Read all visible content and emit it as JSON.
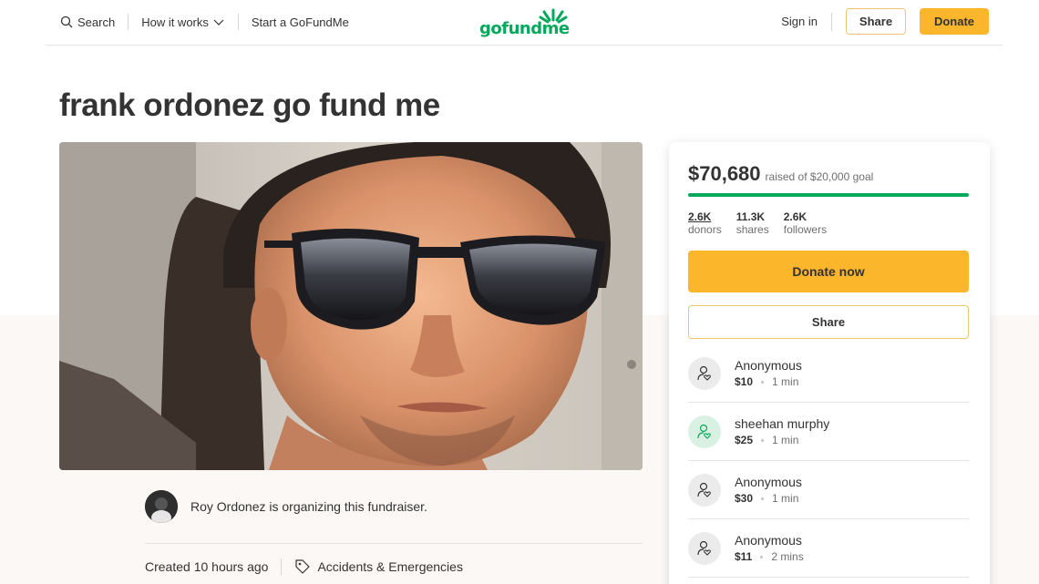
{
  "header": {
    "search_label": "Search",
    "how_it_works_label": "How it works",
    "start_label": "Start a GoFundMe",
    "logo_text": "gofundme",
    "signin_label": "Sign in",
    "share_label": "Share",
    "donate_label": "Donate"
  },
  "page": {
    "title": "frank ordonez go fund me"
  },
  "organizer": {
    "text": "Roy Ordonez is organizing this fundraiser.",
    "created": "Created 10 hours ago",
    "category": "Accidents & Emergencies"
  },
  "sidebar": {
    "raised_amount": "$70,680",
    "raised_goal": "raised of $20,000 goal",
    "progress_fraction": 1.0,
    "stats": [
      {
        "num": "2.6K",
        "label": "donors"
      },
      {
        "num": "11.3K",
        "label": "shares"
      },
      {
        "num": "2.6K",
        "label": "followers"
      }
    ],
    "donate_now_label": "Donate now",
    "share_label": "Share",
    "donations": [
      {
        "name": "Anonymous",
        "amount": "$10",
        "time": "1 min"
      },
      {
        "name": "sheehan murphy",
        "amount": "$25",
        "time": "1 min"
      },
      {
        "name": "Anonymous",
        "amount": "$30",
        "time": "1 min"
      },
      {
        "name": "Anonymous",
        "amount": "$11",
        "time": "2 mins"
      }
    ]
  },
  "colors": {
    "brand_green": "#02a95c",
    "donate_yellow": "#fbb62b",
    "background_beige": "#fbf8f6"
  }
}
